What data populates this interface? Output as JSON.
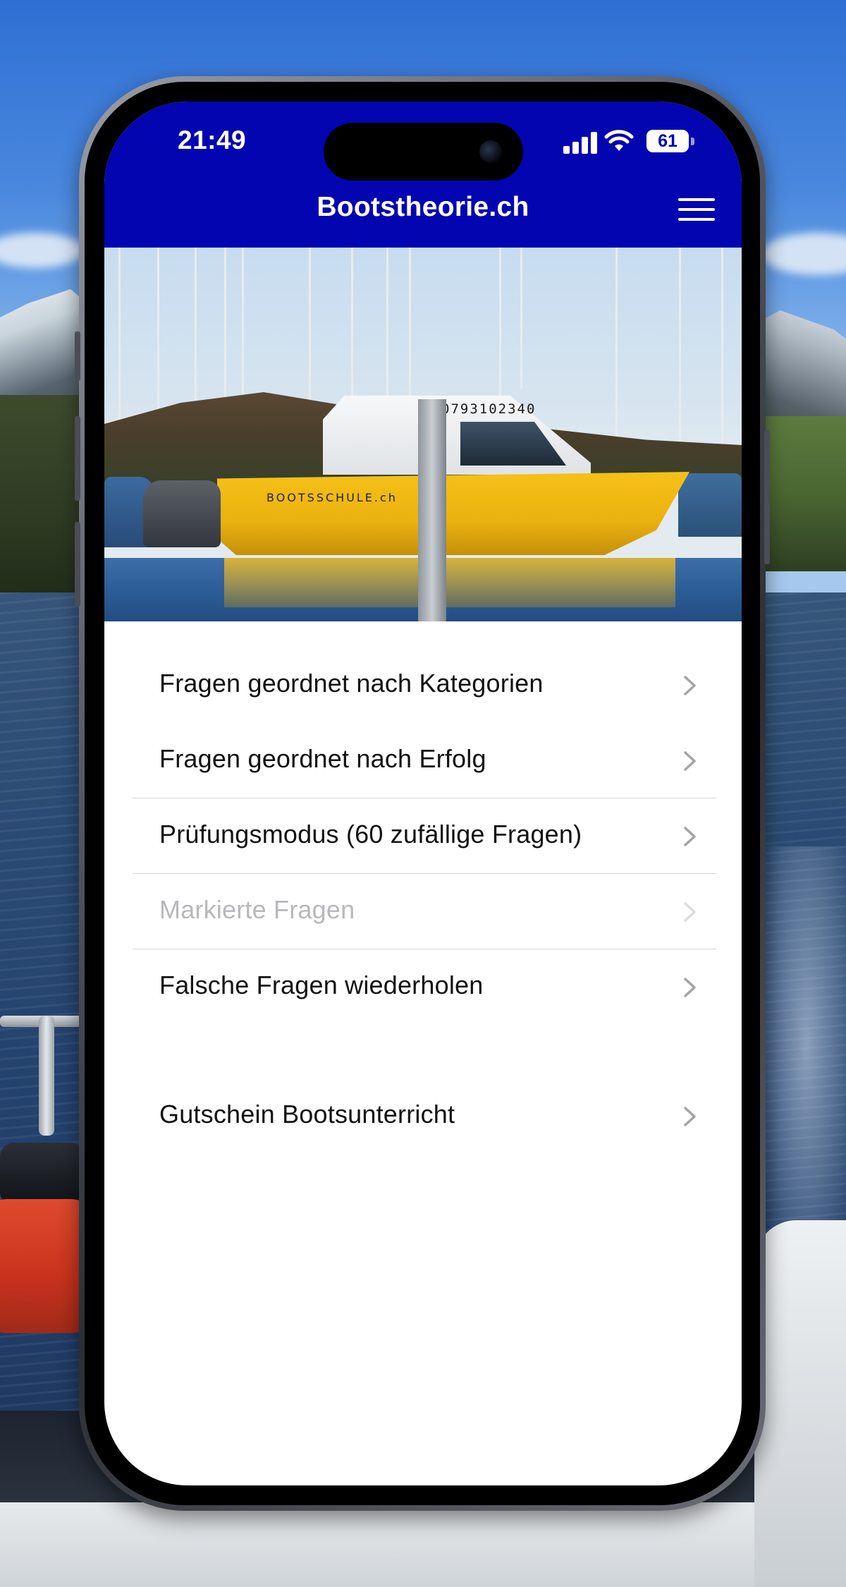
{
  "status_bar": {
    "time": "21:49",
    "battery_level": "61",
    "signal_icon": "cellular-signal-icon",
    "wifi_icon": "wifi-icon",
    "battery_icon": "battery-icon"
  },
  "nav": {
    "title": "Bootstheorie.ch",
    "menu_icon": "hamburger-menu-icon",
    "background_color": "#0305b0"
  },
  "hero": {
    "boat_phone": "0793102340",
    "boat_name": "BOOTSSCHULE.ch"
  },
  "menu": {
    "items": [
      {
        "label": "Fragen geordnet nach Kategorien",
        "enabled": true
      },
      {
        "label": "Fragen geordnet nach Erfolg",
        "enabled": true
      },
      {
        "label": "Prüfungsmodus (60 zufällige Fragen)",
        "enabled": true
      },
      {
        "label": "Markierte Fragen",
        "enabled": false
      },
      {
        "label": "Falsche Fragen wiederholen",
        "enabled": true
      },
      {
        "label": "Gutschein Bootsunterricht",
        "enabled": true
      }
    ],
    "chevron_icon": "chevron-right-icon"
  }
}
